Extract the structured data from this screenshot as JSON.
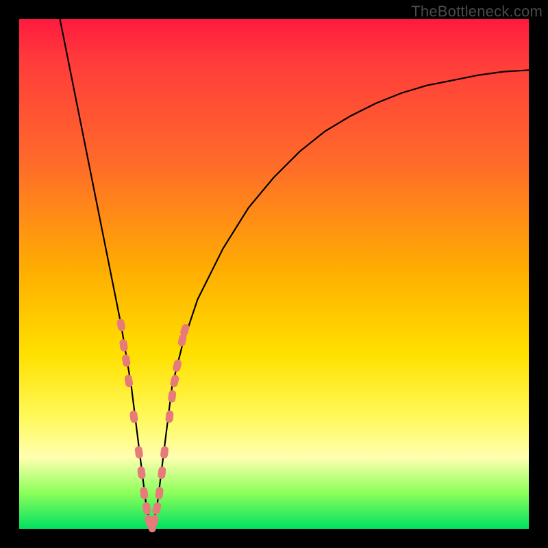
{
  "watermark": "TheBottleneck.com",
  "chart_data": {
    "type": "line",
    "title": "",
    "xlabel": "",
    "ylabel": "",
    "xlim": [
      0,
      100
    ],
    "ylim": [
      0,
      100
    ],
    "curve": {
      "name": "bottleneck-curve",
      "x": [
        8,
        10,
        12,
        14,
        16,
        18,
        20,
        21,
        22,
        23,
        24,
        25,
        26,
        27,
        28,
        29,
        30,
        32,
        35,
        40,
        45,
        50,
        55,
        60,
        65,
        70,
        75,
        80,
        85,
        90,
        95,
        100
      ],
      "y": [
        100,
        90,
        80,
        70,
        60,
        50,
        40,
        34,
        28,
        20,
        12,
        4,
        0,
        4,
        12,
        20,
        28,
        36,
        45,
        55,
        63,
        69,
        74,
        78,
        81,
        83.5,
        85.5,
        87,
        88,
        89,
        89.7,
        90
      ]
    },
    "markers": {
      "name": "data-points",
      "color": "#e77a7a",
      "points": [
        {
          "x": 20.0,
          "y": 40
        },
        {
          "x": 20.5,
          "y": 36
        },
        {
          "x": 21.0,
          "y": 33
        },
        {
          "x": 21.5,
          "y": 29
        },
        {
          "x": 22.5,
          "y": 22
        },
        {
          "x": 23.5,
          "y": 15
        },
        {
          "x": 24.0,
          "y": 11
        },
        {
          "x": 24.5,
          "y": 7
        },
        {
          "x": 25.0,
          "y": 4
        },
        {
          "x": 25.5,
          "y": 1.5
        },
        {
          "x": 26.0,
          "y": 0.5
        },
        {
          "x": 26.5,
          "y": 1.5
        },
        {
          "x": 27.0,
          "y": 4
        },
        {
          "x": 27.5,
          "y": 7
        },
        {
          "x": 28.0,
          "y": 11
        },
        {
          "x": 28.5,
          "y": 15
        },
        {
          "x": 29.5,
          "y": 22
        },
        {
          "x": 30.0,
          "y": 26
        },
        {
          "x": 30.5,
          "y": 29
        },
        {
          "x": 31.0,
          "y": 32
        },
        {
          "x": 32.0,
          "y": 37
        },
        {
          "x": 32.5,
          "y": 39
        }
      ]
    },
    "gradient_colors": {
      "top": "#ff1a3f",
      "mid_upper": "#ff6a2a",
      "mid": "#ffe100",
      "mid_lower": "#ffffb0",
      "bottom": "#00e060"
    }
  }
}
